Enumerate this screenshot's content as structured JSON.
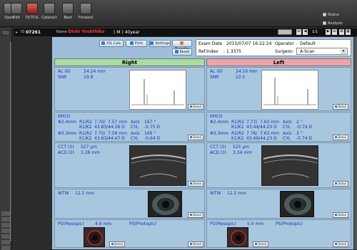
{
  "toolbar": {
    "buttons": [
      {
        "label": "Open",
        "icon": "folder-icon"
      },
      {
        "label": "Edit",
        "icon": "edit-icon"
      },
      {
        "label": "OCTCtL",
        "icon": "octctl-icon"
      },
      {
        "label": "Cataract",
        "icon": "cataract-icon"
      },
      {
        "label": "Best",
        "icon": "best-icon"
      },
      {
        "label": "Forward",
        "icon": "forward-icon"
      }
    ],
    "checkboxes": [
      {
        "label": "Status"
      },
      {
        "label": "Analysis"
      }
    ]
  },
  "patient": {
    "id_label": "ID",
    "id": "07261",
    "name_label": "Name",
    "name": "Oishi Yoshihiko",
    "sex_age": "( M )  40year",
    "page": "1/1"
  },
  "actions": {
    "iol_calc": "IOL Calc",
    "print": "Print",
    "settings": "Settings",
    "transfer": "Transfer",
    "reset": "Reset"
  },
  "exam": {
    "date_label": "Exam Date",
    "date": "2015/07/07 16:22:24",
    "operator_label": "Operator",
    "operator": "Default",
    "ref_label": "Ref.Index",
    "ref": "1.3375",
    "surgeon_label": "Surgeon",
    "surgeon": "A-Scan"
  },
  "right": {
    "header": "Right",
    "al_label": "AL  (6)",
    "al_value": "24.24 mm",
    "snr_label": "SNR",
    "snr_value": "19.8",
    "km_label": "KM(3)",
    "km_r1": [
      "Φ2.4mm",
      "R1/R2",
      "7.70/",
      "7.57 mm",
      "Axis",
      "167 °"
    ],
    "km_k1": [
      "K1/K2",
      "43.83/",
      "44.58 D",
      "CYL",
      "-0.75 D"
    ],
    "km_r2": [
      "Φ3.3mm",
      "R1/R2",
      "7.70/",
      "7.59 mm",
      "Axis",
      "169 °"
    ],
    "km_k2": [
      "K1/K2",
      "43.83/",
      "44.47 D",
      "CYL",
      "-0.64 D"
    ],
    "cct_label": "CCT (3)",
    "cct_value": "527 μm",
    "acd_label": "ACD (3)",
    "acd_value": "3.28 mm",
    "wtw_label": "WTW",
    "wtw_value": "12.1 mm",
    "ps_mesopic_label": "PS(Mesopic)",
    "ps_mesopic_value": "4.6 mm",
    "ps_photopic_label": "PS(Photopic)"
  },
  "left": {
    "header": "Left",
    "al_label": "AL  (6)",
    "al_value": "24.50 mm",
    "snr_label": "SNR",
    "snr_value": "22.5",
    "km_label": "KM(3)",
    "km_r1": [
      "Φ2.4mm",
      "R1/R2",
      "7.77/",
      "7.63 mm",
      "Axis",
      "2 °"
    ],
    "km_k1": [
      "K1/K2",
      "43.44/",
      "44.23 D",
      "CYL",
      "-0.79 D"
    ],
    "km_r2": [
      "Φ3.3mm",
      "R1/R2",
      "7.76/",
      "7.63 mm",
      "Axis",
      "3 °"
    ],
    "km_k2": [
      "K1/K2",
      "43.49/",
      "44.23 D",
      "CYL",
      "-0.74 D"
    ],
    "cct_label": "CCT (3)",
    "cct_value": "525 μm",
    "acd_label": "ACD (3)",
    "acd_value": "3.34 mm",
    "wtw_label": "WTW",
    "wtw_value": "12.2 mm",
    "ps_mesopic_label": "PS(Mesopic)",
    "ps_mesopic_value": "5.0 mm",
    "ps_photopic_label": "PS(Photopic)"
  },
  "detail_label": "Detail",
  "colors": {
    "right_header": "#a8dca0",
    "left_header": "#f2a2aa",
    "label_blue": "#1034b8",
    "patient_name": "#ff3b3b"
  }
}
